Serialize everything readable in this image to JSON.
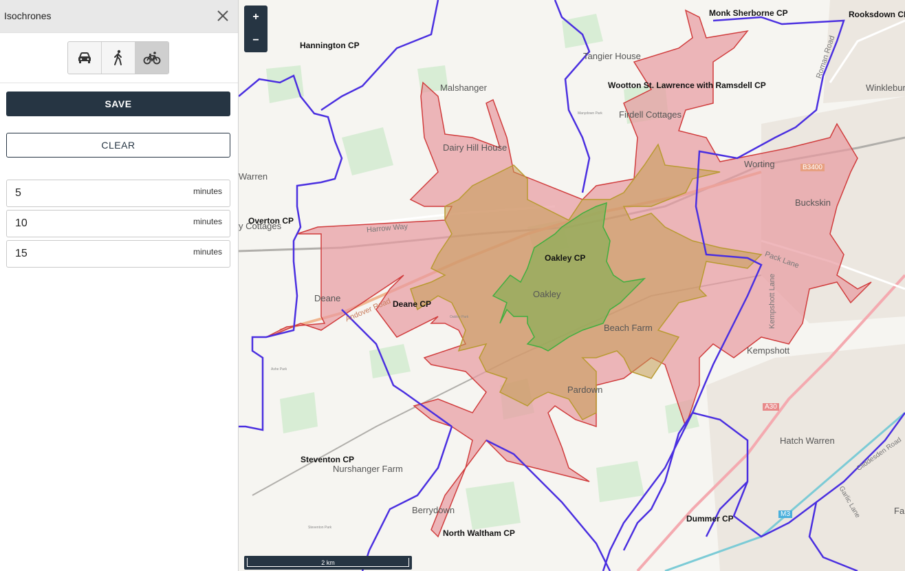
{
  "panel": {
    "title": "Isochrones",
    "modes": [
      {
        "name": "car",
        "active": false
      },
      {
        "name": "walk",
        "active": false
      },
      {
        "name": "bike",
        "active": true
      }
    ],
    "save_label": "SAVE",
    "clear_label": "CLEAR",
    "times": [
      {
        "value": "5",
        "unit": "minutes"
      },
      {
        "value": "10",
        "unit": "minutes"
      },
      {
        "value": "15",
        "unit": "minutes"
      }
    ]
  },
  "map": {
    "zoom_in": "+",
    "zoom_out": "−",
    "scale_label": "2 km",
    "parish_labels": [
      "Monk Sherborne CP",
      "Rooksdown CP",
      "Hannington CP",
      "Wootton St. Lawrence with Ramsdell CP",
      "Overton CP",
      "Oakley CP",
      "Deane CP",
      "Steventon CP",
      "North Waltham CP",
      "Dummer CP"
    ],
    "place_labels": [
      "Tangier House",
      "Malshanger",
      "Winklebury",
      "Firdell Cottages",
      "Dairy Hill House",
      "Warren",
      "Worting",
      "Buckskin",
      "y Cottages",
      "Oakley",
      "Deane",
      "Beach Farm",
      "Kempshott",
      "Pardown",
      "Hatch Warren",
      "Nurshanger Farm",
      "Berrydown",
      "Fa"
    ],
    "road_labels": [
      "Roman Road",
      "B3400",
      "Harrow Way",
      "Andover Road",
      "Pack Lane",
      "Kempshott Lane",
      "A30",
      "M3",
      "Cliddesden Road",
      "Garlic Lane"
    ],
    "minor_labels": [
      "Manydown Park",
      "Oakley Park",
      "Ashe Park",
      "Steventon Park"
    ],
    "colors": {
      "iso_15": "#e89aa0",
      "iso_10": "#c49a52",
      "iso_5": "#8fae5a",
      "boundary": "#4a2fe0"
    }
  }
}
